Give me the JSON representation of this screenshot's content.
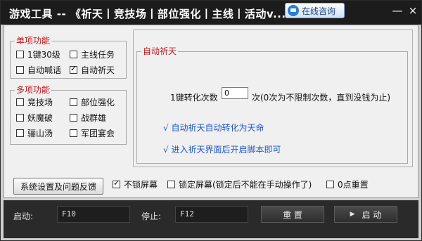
{
  "titlebar": {
    "title": "游戏工具 -- 《祈天丨竞技场丨部位强化丨主线丨活动v...",
    "consult_label": "在线咨询",
    "minimize": "—",
    "close": "×"
  },
  "single_group": {
    "label": "单项功能",
    "items": [
      {
        "label": "1键30级",
        "checked": false
      },
      {
        "label": "主线任务",
        "checked": false
      },
      {
        "label": "自动喊话",
        "checked": false
      },
      {
        "label": "自动祈天",
        "checked": true
      }
    ]
  },
  "multi_group": {
    "label": "多项功能",
    "items": [
      {
        "label": "竞技场",
        "checked": false
      },
      {
        "label": "部位强化",
        "checked": false
      },
      {
        "label": "妖魔破",
        "checked": false
      },
      {
        "label": "战群雄",
        "checked": false
      },
      {
        "label": "骊山汤",
        "checked": false
      },
      {
        "label": "军团宴会",
        "checked": false
      }
    ]
  },
  "auto_pray": {
    "label": "自动祈天",
    "convert_label": "1键转化次数",
    "convert_value": "0",
    "convert_hint": "次(0次为不限制次数，直到没钱为止)",
    "note1": "√ 自动祈天自动转化为天命",
    "note2": "√ 进入祈天界面后开启脚本即可"
  },
  "feedback_button": "系统设置及问题反馈",
  "options": [
    {
      "label": "不锁屏幕",
      "checked": true
    },
    {
      "label": "锁定屏幕(锁定后不能在手动操作了)",
      "checked": false
    },
    {
      "label": "0点重置",
      "checked": false
    }
  ],
  "bottom": {
    "start_label": "启动:",
    "start_key": "F10",
    "stop_label": "停止:",
    "stop_key": "F12",
    "reset_button": "重 置",
    "start_button": "启 动"
  }
}
